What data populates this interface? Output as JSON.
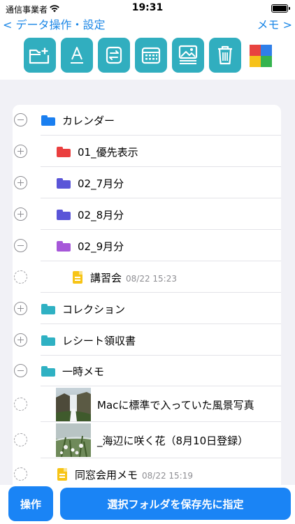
{
  "status_bar": {
    "carrier": "通信事業者",
    "time": "19:31"
  },
  "nav": {
    "back_label": "< データ操作・設定",
    "forward_label": "メモ >"
  },
  "toolbar": {
    "buttons": [
      {
        "icon": "new-folder-icon"
      },
      {
        "icon": "text-format-icon"
      },
      {
        "icon": "move-icon"
      },
      {
        "icon": "calendar-icon"
      },
      {
        "icon": "image-icon"
      },
      {
        "icon": "trash-icon"
      }
    ],
    "accent_color": "#31aebf",
    "color_picker": [
      "#e84340",
      "#2f7fe8",
      "#f6c21a",
      "#35b34e"
    ]
  },
  "list": {
    "items": [
      {
        "type": "folder",
        "expander": "minus",
        "label": "カレンダー",
        "color": "#1a7ff0"
      },
      {
        "type": "folder",
        "expander": "plus",
        "label": "01_優先表示",
        "color": "#ea3f3f"
      },
      {
        "type": "folder",
        "expander": "plus",
        "label": "02_7月分",
        "color": "#5a55d8"
      },
      {
        "type": "folder",
        "expander": "plus",
        "label": "02_8月分",
        "color": "#5a55d8"
      },
      {
        "type": "folder",
        "expander": "minus",
        "label": "02_9月分",
        "color": "#a657d9"
      },
      {
        "type": "memo",
        "expander": "dashed",
        "label": "講習会",
        "time": "08/22 15:23"
      },
      {
        "type": "folder",
        "expander": "plus",
        "label": "コレクション",
        "color": "#2fb1c3"
      },
      {
        "type": "folder",
        "expander": "plus",
        "label": "レシート領収書",
        "color": "#2fb1c3"
      },
      {
        "type": "folder",
        "expander": "minus",
        "label": "一時メモ",
        "color": "#2fb1c3"
      },
      {
        "type": "image-memo",
        "expander": "dashed",
        "label": "Macに標準で入っていた風景写真",
        "thumb": "waterfall-photo"
      },
      {
        "type": "image-memo",
        "expander": "dashed",
        "label": "_海辺に咲く花（8月10日登録）",
        "thumb": "flower-photo"
      },
      {
        "type": "memo",
        "expander": "dashed",
        "label": "同窓会用メモ",
        "time": "08/22 15:19"
      }
    ]
  },
  "bottom": {
    "operation_label": "操作",
    "set_destination_label": "選択フォルダを保存先に指定"
  },
  "colors": {
    "primary": "#1a84f5",
    "background": "#f1f1f6"
  }
}
